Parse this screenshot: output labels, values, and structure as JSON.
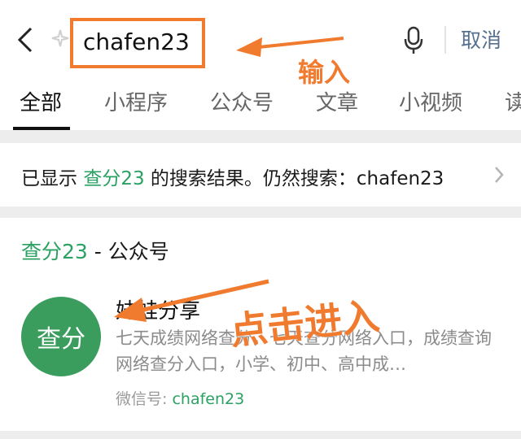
{
  "search": {
    "value": "chafen23",
    "cancel_label": "取消"
  },
  "tabs": [
    {
      "label": "全部"
    },
    {
      "label": "小程序"
    },
    {
      "label": "公众号"
    },
    {
      "label": "文章"
    },
    {
      "label": "小视频"
    },
    {
      "label": "读"
    }
  ],
  "notice": {
    "prefix": "已显示 ",
    "term": "查分23",
    "suffix": " 的搜索结果。仍然搜索：chafen23"
  },
  "result": {
    "section_name": "查分23",
    "section_suffix": " - 公众号",
    "avatar_text": "查分",
    "account_name": "妹蛙分享",
    "description": "七天成绩网络查分，七天查分网络入口，成绩查询网络查分入口，小学、初中、高中成…",
    "id_label": "微信号: ",
    "id_value": "chafen23"
  },
  "annotations": {
    "input_label": "输入",
    "click_label": "点击进入",
    "color": "#f07a2e"
  },
  "colors": {
    "accent_green": "#2aa163",
    "link_blue": "#56708f",
    "avatar_green": "#3a9d5d"
  }
}
